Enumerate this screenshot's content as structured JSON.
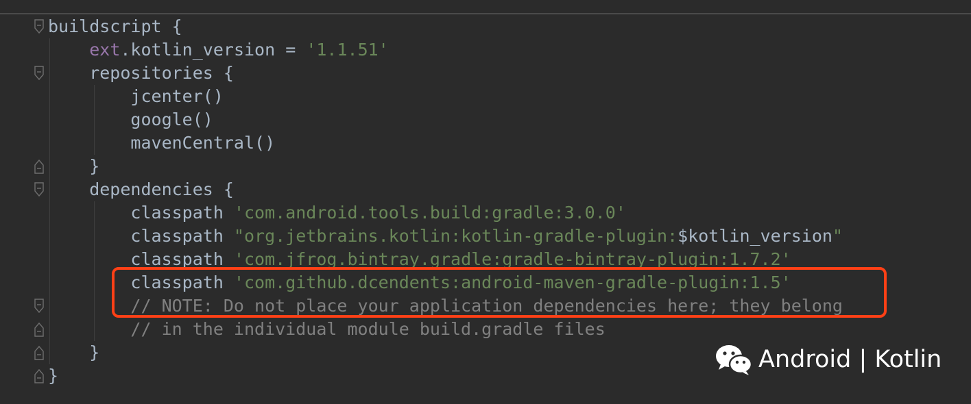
{
  "editor": {
    "lines": [
      {
        "segments": [
          {
            "text": "buildscript {",
            "kind": "plain"
          }
        ]
      },
      {
        "segments": [
          {
            "text": "    ",
            "kind": "plain"
          },
          {
            "text": "ext",
            "kind": "ext"
          },
          {
            "text": ".kotlin_version = ",
            "kind": "plain"
          },
          {
            "text": "'1.1.51'",
            "kind": "string"
          }
        ]
      },
      {
        "segments": [
          {
            "text": "    repositories {",
            "kind": "plain"
          }
        ]
      },
      {
        "segments": [
          {
            "text": "        jcenter()",
            "kind": "plain"
          }
        ]
      },
      {
        "segments": [
          {
            "text": "        google()",
            "kind": "plain"
          }
        ]
      },
      {
        "segments": [
          {
            "text": "        mavenCentral()",
            "kind": "plain"
          }
        ]
      },
      {
        "segments": [
          {
            "text": "    }",
            "kind": "plain"
          }
        ]
      },
      {
        "segments": [
          {
            "text": "    dependencies {",
            "kind": "plain"
          }
        ]
      },
      {
        "segments": [
          {
            "text": "        classpath ",
            "kind": "plain"
          },
          {
            "text": "'com.android.tools.build:gradle:3.0.0'",
            "kind": "string"
          }
        ]
      },
      {
        "segments": [
          {
            "text": "        classpath ",
            "kind": "plain"
          },
          {
            "text": "\"org.jetbrains.kotlin:kotlin-gradle-plugin:",
            "kind": "string"
          },
          {
            "text": "$kotlin_version",
            "kind": "var"
          },
          {
            "text": "\"",
            "kind": "string"
          }
        ]
      },
      {
        "segments": [
          {
            "text": "        classpath ",
            "kind": "plain"
          },
          {
            "text": "'com.jfrog.bintray.gradle:gradle-bintray-plugin:1.7.2'",
            "kind": "string"
          }
        ]
      },
      {
        "segments": [
          {
            "text": "        classpath ",
            "kind": "plain"
          },
          {
            "text": "'com.github.dcendents:android-maven-gradle-plugin:1.5'",
            "kind": "string"
          }
        ]
      },
      {
        "segments": [
          {
            "text": "        // NOTE: Do not place your application dependencies here; they belong",
            "kind": "comment"
          }
        ]
      },
      {
        "segments": [
          {
            "text": "        // in the individual module build.gradle files",
            "kind": "comment"
          }
        ]
      },
      {
        "segments": [
          {
            "text": "    }",
            "kind": "plain"
          }
        ]
      },
      {
        "segments": [
          {
            "text": "}",
            "kind": "plain"
          }
        ]
      }
    ],
    "fold_markers": [
      {
        "line": 0,
        "type": "open"
      },
      {
        "line": 2,
        "type": "open"
      },
      {
        "line": 6,
        "type": "close"
      },
      {
        "line": 7,
        "type": "open"
      },
      {
        "line": 12,
        "type": "open"
      },
      {
        "line": 13,
        "type": "close"
      },
      {
        "line": 14,
        "type": "close"
      },
      {
        "line": 15,
        "type": "close"
      }
    ],
    "highlighted_lines": [
      10,
      11
    ],
    "colors": {
      "background": "#2b2b2b",
      "text": "#a9b7c6",
      "string": "#6a8759",
      "ext_keyword": "#9876aa",
      "comment": "#808080",
      "highlight_border": "#ff4016"
    }
  },
  "watermark": {
    "icon": "wechat-icon",
    "text": "Android | Kotlin"
  }
}
